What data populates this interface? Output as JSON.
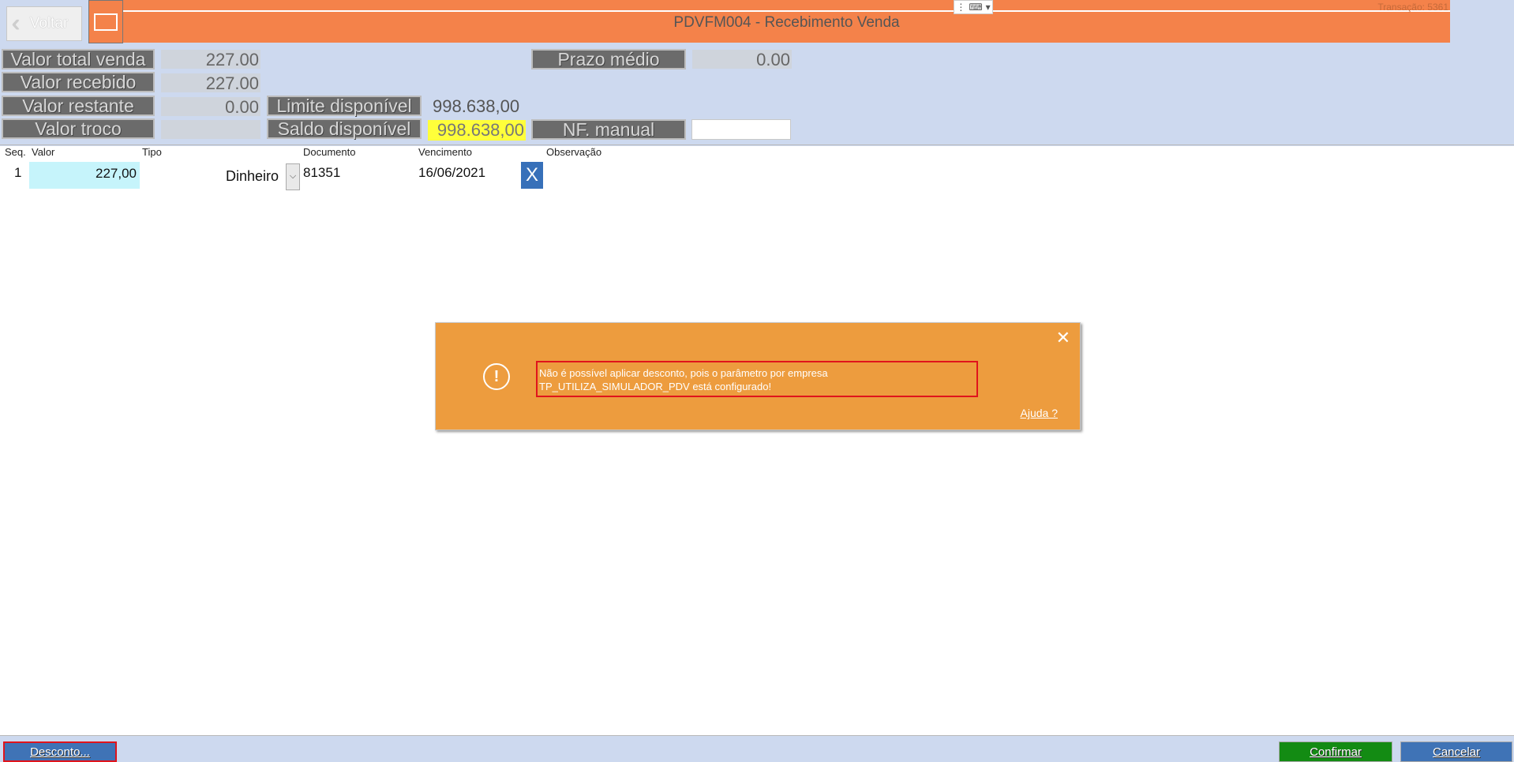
{
  "header": {
    "back_label": "Voltar",
    "title": "PDVFM004 - Recebimento Venda",
    "transaction": "Transação: 5361"
  },
  "summary": {
    "valor_total_venda": {
      "label": "Valor total venda",
      "value": "227.00"
    },
    "valor_recebido": {
      "label": "Valor recebido",
      "value": "227.00"
    },
    "valor_restante": {
      "label": "Valor restante",
      "value": "0.00"
    },
    "valor_troco": {
      "label": "Valor troco",
      "value": ""
    },
    "limite_disponivel": {
      "label": "Limite disponível",
      "value": "998.638,00"
    },
    "saldo_disponivel": {
      "label": "Saldo disponível",
      "value": "998.638,00"
    },
    "prazo_medio": {
      "label": "Prazo médio",
      "value": "0.00"
    },
    "nf_manual": {
      "label": "NF. manual",
      "value": ""
    }
  },
  "grid": {
    "columns": {
      "seq": "Seq.",
      "valor": "Valor",
      "tipo": "Tipo",
      "documento": "Documento",
      "vencimento": "Vencimento",
      "observacao": "Observação"
    },
    "rows": [
      {
        "seq": "1",
        "valor": "227,00",
        "tipo": "Dinheiro",
        "documento": "81351",
        "vencimento": "16/06/2021",
        "delete": "X"
      }
    ]
  },
  "dialog": {
    "message": "Não é possível aplicar desconto, pois o parâmetro por empresa TP_UTILIZA_SIMULADOR_PDV está configurado!",
    "help": "Ajuda ?",
    "close": "✕",
    "icon": "!"
  },
  "footer": {
    "desconto": "Desconto...",
    "confirmar": "Confirmar",
    "cancelar": "Cancelar"
  },
  "colors": {
    "header_orange": "#f4824a",
    "dialog_orange": "#ed9c3e",
    "panel_blue": "#cdd9ef",
    "confirm_green": "#138b13",
    "button_blue": "#3f73b6",
    "highlight_yellow": "#ffff3a"
  }
}
